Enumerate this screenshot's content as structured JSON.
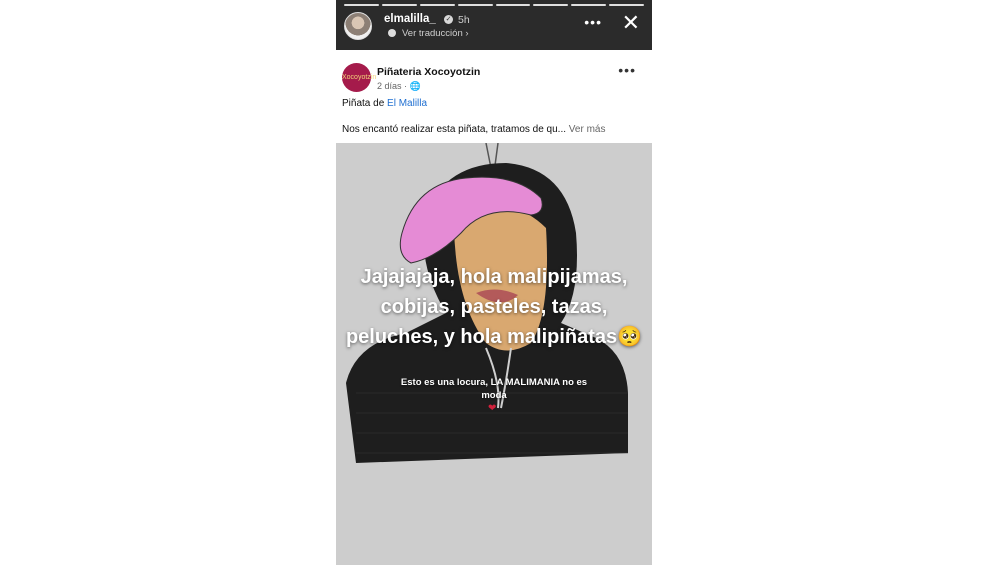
{
  "story": {
    "username": "elmalilla_",
    "time": "5h",
    "translate_label": "Ver traducción",
    "verified_glyph": "✓",
    "more_glyph": "•••",
    "close_glyph": "✕",
    "progress_segments": 8
  },
  "post": {
    "page_name": "Piñateria Xocoyotzin",
    "time": "2 días · ",
    "audience_icon": "globe-icon",
    "logo_text": "Xocoyotzin",
    "more_glyph": "•••",
    "tag_prefix": "Piñata de ",
    "tag_link": "El Malilla",
    "caption": "Nos encantó realizar esta piñata, tratamos de qu... ",
    "see_more": "Ver más"
  },
  "overlay": {
    "main_text": "Jajajajaja, hola malipijamas, cobijas, pasteles, tazas, peluches, y hola malipiñatas🥺",
    "small_text": "Esto es una locura, LA MALIMANIA no es moda",
    "heart": "❤"
  },
  "colors": {
    "story_bg": "#2b2b2b",
    "link": "#1f6fd1",
    "logo_bg": "#a51b4b",
    "cap_pink": "#e58bd5",
    "hoodie": "#1e1e1e",
    "skin": "#d9a870"
  }
}
